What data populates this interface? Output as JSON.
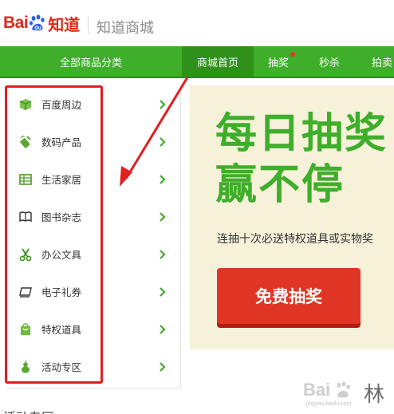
{
  "header": {
    "logo_bai": "Bai",
    "logo_du": "du",
    "logo_zhidao": "知道",
    "subtitle": "知道商城"
  },
  "nav": {
    "all_categories": "全部商品分类",
    "items": [
      {
        "label": "商城首页",
        "active": true
      },
      {
        "label": "抽奖",
        "badge_dot": true
      },
      {
        "label": "秒杀"
      },
      {
        "label": "拍卖"
      }
    ]
  },
  "sidebar": {
    "items": [
      {
        "label": "百度周边",
        "icon": "gift-box-icon"
      },
      {
        "label": "数码产品",
        "icon": "usb-drive-icon"
      },
      {
        "label": "生活家居",
        "icon": "home-grid-icon"
      },
      {
        "label": "图书杂志",
        "icon": "book-icon"
      },
      {
        "label": "办公文具",
        "icon": "scissors-icon"
      },
      {
        "label": "电子礼券",
        "icon": "ticket-icon"
      },
      {
        "label": "特权道具",
        "icon": "bag-icon"
      },
      {
        "label": "活动专区",
        "icon": "gourd-icon"
      }
    ]
  },
  "banner": {
    "line1": "每日抽奖",
    "line2": "赢不停",
    "subtitle": "连抽十次必送特权道具或实物奖",
    "cta": "免费抽奖"
  },
  "bottom": {
    "partial_text": "活动专区"
  },
  "watermark": {
    "text": "Bai",
    "small": "jingyan.baidu.com",
    "suffix": "林"
  },
  "colors": {
    "brand_red": "#e0281a",
    "nav_green": "#3fae2a",
    "annotation_red": "#e11f1f",
    "cta_red": "#e03524",
    "banner_bg": "#f6f2da"
  }
}
